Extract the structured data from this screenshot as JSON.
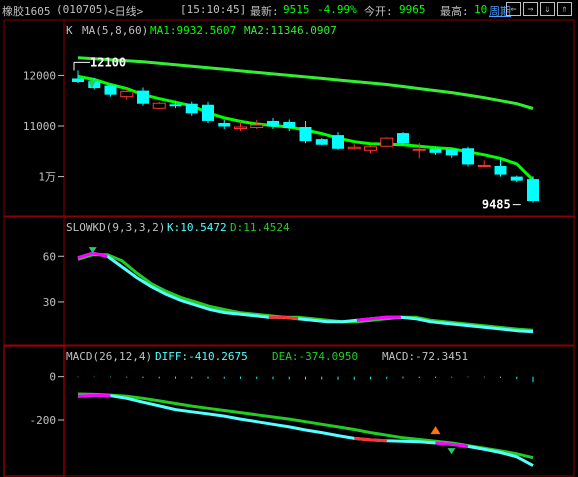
{
  "header": {
    "symbol_name": "橡胶1605",
    "symbol_code": "(010705)",
    "period": "<日线>",
    "time": "[15:10:45]",
    "latest_label": "最新:",
    "latest_value": "9515",
    "change_pct": "-4.99%",
    "open_label": "今开:",
    "open_value": "9965",
    "high_label": "最高:",
    "high_value": "10",
    "cycle_link": "周期",
    "nav_buttons": [
      "⇐",
      "⇒",
      "⇓",
      "⇑"
    ]
  },
  "colors": {
    "up": "#ff3232",
    "down": "#00ffff",
    "ma1": "#00ff00",
    "ma2": "#33ee33",
    "k_line": "#54ffff",
    "d_line": "#22cc22",
    "diff_line": "#54ffff",
    "dea_line": "#22cc22",
    "highlight": "#ff00ff",
    "grid": "#880000"
  },
  "chart_data": [
    {
      "type": "candlestick",
      "title": "K",
      "indicator_label": "MA(5,8,60)",
      "ma1_label": "MA1:9932.5607",
      "ma2_label": "MA2:11346.0907",
      "y_ticks": [
        "12000",
        "11000",
        "1万"
      ],
      "y_tick_values": [
        12000,
        11000,
        10000
      ],
      "ylim": [
        9300,
        12700
      ],
      "annotations": [
        {
          "text": "12100",
          "value": 12100,
          "index": 0
        },
        {
          "text": "9485",
          "value": 9485,
          "index": 27
        }
      ],
      "candles": [
        {
          "o": 11940,
          "h": 12100,
          "l": 11850,
          "c": 11870
        },
        {
          "o": 11880,
          "h": 11950,
          "l": 11720,
          "c": 11750
        },
        {
          "o": 11800,
          "h": 11820,
          "l": 11580,
          "c": 11620
        },
        {
          "o": 11580,
          "h": 11740,
          "l": 11520,
          "c": 11680
        },
        {
          "o": 11700,
          "h": 11760,
          "l": 11400,
          "c": 11440
        },
        {
          "o": 11350,
          "h": 11480,
          "l": 11340,
          "c": 11450
        },
        {
          "o": 11430,
          "h": 11500,
          "l": 11350,
          "c": 11390
        },
        {
          "o": 11440,
          "h": 11480,
          "l": 11200,
          "c": 11250
        },
        {
          "o": 11420,
          "h": 11480,
          "l": 11060,
          "c": 11100
        },
        {
          "o": 11060,
          "h": 11120,
          "l": 10940,
          "c": 10990
        },
        {
          "o": 10950,
          "h": 11100,
          "l": 10900,
          "c": 10980
        },
        {
          "o": 10970,
          "h": 11120,
          "l": 10940,
          "c": 11020
        },
        {
          "o": 11100,
          "h": 11160,
          "l": 10940,
          "c": 10990
        },
        {
          "o": 11080,
          "h": 11130,
          "l": 10900,
          "c": 10960
        },
        {
          "o": 10980,
          "h": 11100,
          "l": 10660,
          "c": 10700
        },
        {
          "o": 10740,
          "h": 10760,
          "l": 10620,
          "c": 10630
        },
        {
          "o": 10820,
          "h": 10880,
          "l": 10530,
          "c": 10550
        },
        {
          "o": 10550,
          "h": 10640,
          "l": 10530,
          "c": 10580
        },
        {
          "o": 10520,
          "h": 10620,
          "l": 10460,
          "c": 10590
        },
        {
          "o": 10600,
          "h": 10780,
          "l": 10590,
          "c": 10760
        },
        {
          "o": 10860,
          "h": 10880,
          "l": 10620,
          "c": 10660
        },
        {
          "o": 10540,
          "h": 10660,
          "l": 10360,
          "c": 10540
        },
        {
          "o": 10550,
          "h": 10600,
          "l": 10430,
          "c": 10470
        },
        {
          "o": 10540,
          "h": 10560,
          "l": 10370,
          "c": 10420
        },
        {
          "o": 10560,
          "h": 10590,
          "l": 10200,
          "c": 10240
        },
        {
          "o": 10220,
          "h": 10320,
          "l": 10180,
          "c": 10220
        },
        {
          "o": 10210,
          "h": 10350,
          "l": 10000,
          "c": 10040
        },
        {
          "o": 10000,
          "h": 10020,
          "l": 9890,
          "c": 9920
        },
        {
          "o": 9950,
          "h": 10010,
          "l": 9485,
          "c": 9515
        }
      ],
      "ma1": [
        11980,
        11920,
        11820,
        11740,
        11620,
        11540,
        11470,
        11400,
        11260,
        11160,
        11090,
        11040,
        11010,
        10980,
        10920,
        10850,
        10760,
        10690,
        10650,
        10640,
        10630,
        10600,
        10570,
        10550,
        10490,
        10430,
        10360,
        10250,
        9932.5607
      ],
      "ma2": [
        12350,
        12330,
        12310,
        12290,
        12270,
        12240,
        12210,
        12180,
        12150,
        12120,
        12090,
        12060,
        12030,
        12000,
        11970,
        11940,
        11910,
        11880,
        11850,
        11820,
        11780,
        11740,
        11700,
        11660,
        11610,
        11560,
        11500,
        11440,
        11346.0907
      ]
    },
    {
      "type": "line",
      "title": "SLOWKD(9,3,3,2)",
      "k_label": "K:10.5472",
      "d_label": "D:11.4524",
      "y_ticks": [
        "60",
        "30"
      ],
      "y_tick_values": [
        60,
        30
      ],
      "ylim": [
        5,
        72
      ],
      "series": [
        {
          "name": "K",
          "values": [
            59,
            62,
            60,
            53,
            46,
            40,
            35,
            31,
            28,
            25,
            23,
            22,
            21,
            20,
            20,
            19,
            18,
            17,
            17,
            18,
            19,
            20,
            20,
            19,
            17,
            16,
            15,
            14,
            13,
            12,
            11,
            10.5472
          ]
        },
        {
          "name": "D",
          "values": [
            58,
            61,
            61,
            57,
            49,
            42,
            37,
            33,
            30,
            27,
            25,
            23,
            22,
            21,
            20,
            20,
            19,
            18,
            17,
            17,
            18,
            19,
            20,
            20,
            18,
            17,
            16,
            15,
            14,
            13,
            12,
            11.4524
          ]
        }
      ]
    },
    {
      "type": "line",
      "title": "MACD(26,12,4)",
      "diff_label": "DIFF:-410.2675",
      "dea_label": "DEA:-374.0950",
      "macd_label": "MACD:-72.3451",
      "y_ticks": [
        "0",
        "-200"
      ],
      "y_tick_values": [
        0,
        -200
      ],
      "ylim": [
        -440,
        40
      ],
      "series": [
        {
          "name": "DIFF",
          "values": [
            -90,
            -85,
            -88,
            -100,
            -118,
            -135,
            -152,
            -162,
            -172,
            -182,
            -196,
            -208,
            -220,
            -232,
            -246,
            -258,
            -272,
            -285,
            -292,
            -296,
            -298,
            -300,
            -306,
            -312,
            -322,
            -335,
            -350,
            -370,
            -410.2675
          ]
        },
        {
          "name": "DEA",
          "values": [
            -80,
            -82,
            -85,
            -90,
            -100,
            -112,
            -124,
            -136,
            -146,
            -156,
            -166,
            -176,
            -186,
            -196,
            -208,
            -220,
            -232,
            -244,
            -258,
            -270,
            -282,
            -290,
            -298,
            -306,
            -318,
            -330,
            -342,
            -356,
            -374.095
          ]
        },
        {
          "name": "MACD",
          "values": [
            -8,
            -6,
            -8,
            -12,
            -18,
            -22,
            -26,
            -24,
            -26,
            -26,
            -28,
            -30,
            -34,
            -36,
            -38,
            -38,
            -40,
            -42,
            -36,
            -30,
            -22,
            -18,
            -16,
            -12,
            -8,
            -10,
            -16,
            -30,
            -72.3451
          ]
        }
      ]
    }
  ]
}
